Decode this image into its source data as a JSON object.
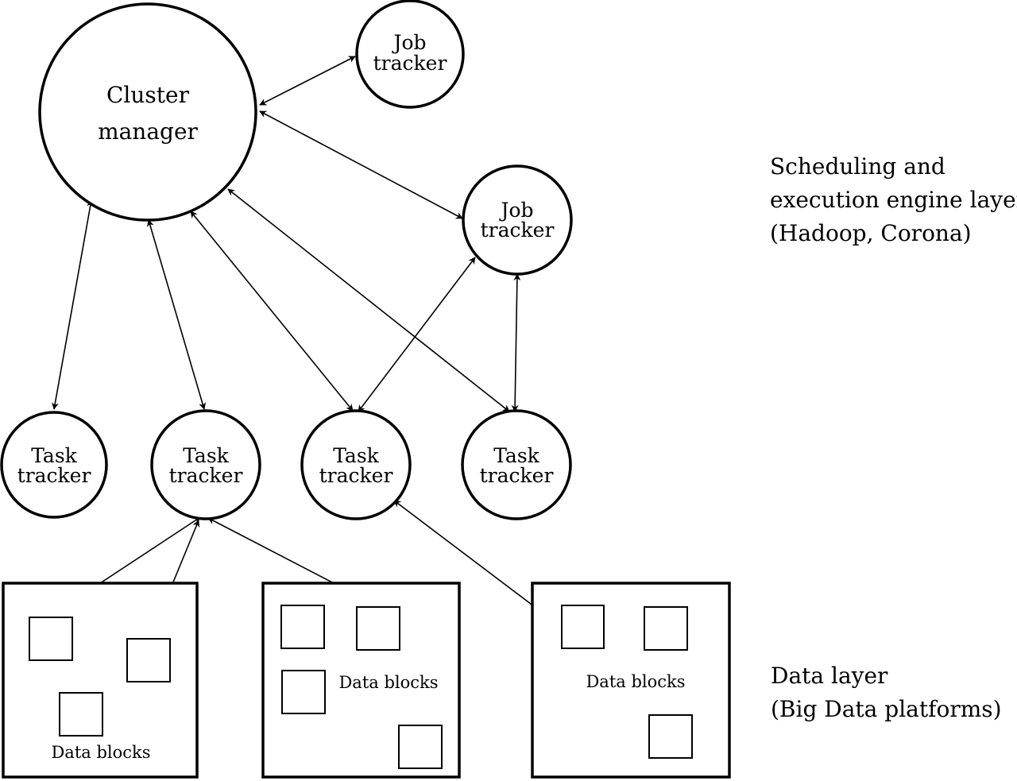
{
  "nodes": {
    "cluster_manager": [
      "Cluster",
      "manager"
    ],
    "job_tracker_1": [
      "Job",
      "tracker"
    ],
    "job_tracker_2": [
      "Job",
      "tracker"
    ],
    "task_tracker_1": [
      "Task",
      "tracker"
    ],
    "task_tracker_2": [
      "Task",
      "tracker"
    ],
    "task_tracker_3": [
      "Task",
      "tracker"
    ],
    "task_tracker_4": [
      "Task",
      "tracker"
    ]
  },
  "data_blocks_label": "Data blocks",
  "layers": {
    "scheduling": [
      "Scheduling and",
      "execution engine layer",
      "(Hadoop, Corona)"
    ],
    "data": [
      "Data layer",
      "(Big Data platforms)"
    ]
  }
}
